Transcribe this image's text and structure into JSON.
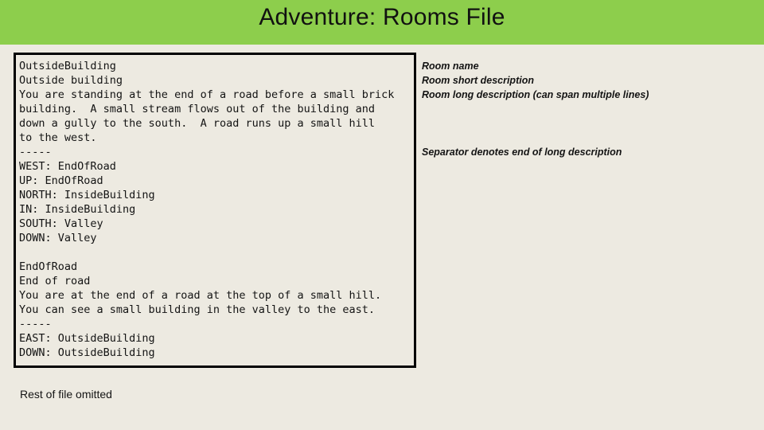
{
  "slide": {
    "title": "Adventure: Rooms File",
    "colors": {
      "title_band": "#8DCE4C",
      "background": "#EDEAE1",
      "text": "#141414",
      "box_border": "#000000"
    }
  },
  "code_block": {
    "language": "plaintext",
    "lines": [
      "OutsideBuilding",
      "Outside building",
      "You are standing at the end of a road before a small brick",
      "building.  A small stream flows out of the building and",
      "down a gully to the south.  A road runs up a small hill",
      "to the west.",
      "-----",
      "WEST: EndOfRoad",
      "UP: EndOfRoad",
      "NORTH: InsideBuilding",
      "IN: InsideBuilding",
      "SOUTH: Valley",
      "DOWN: Valley",
      "",
      "EndOfRoad",
      "End of road",
      "You are at the end of a road at the top of a small hill.",
      "You can see a small building in the valley to the east.",
      "-----",
      "EAST: OutsideBuilding",
      "DOWN: OutsideBuilding"
    ],
    "text": "OutsideBuilding\nOutside building\nYou are standing at the end of a road before a small brick\nbuilding.  A small stream flows out of the building and\ndown a gully to the south.  A road runs up a small hill\nto the west.\n-----\nWEST: EndOfRoad\nUP: EndOfRoad\nNORTH: InsideBuilding\nIN: InsideBuilding\nSOUTH: Valley\nDOWN: Valley\n\nEndOfRoad\nEnd of road\nYou are at the end of a road at the top of a small hill.\nYou can see a small building in the valley to the east.\n-----\nEAST: OutsideBuilding\nDOWN: OutsideBuilding"
  },
  "annotations": {
    "field_labels": [
      "Room name",
      "Room short description",
      "Room long description (can span multiple lines)"
    ],
    "separator_note": "Separator denotes end of long description"
  },
  "footnote": "Rest of file omitted"
}
